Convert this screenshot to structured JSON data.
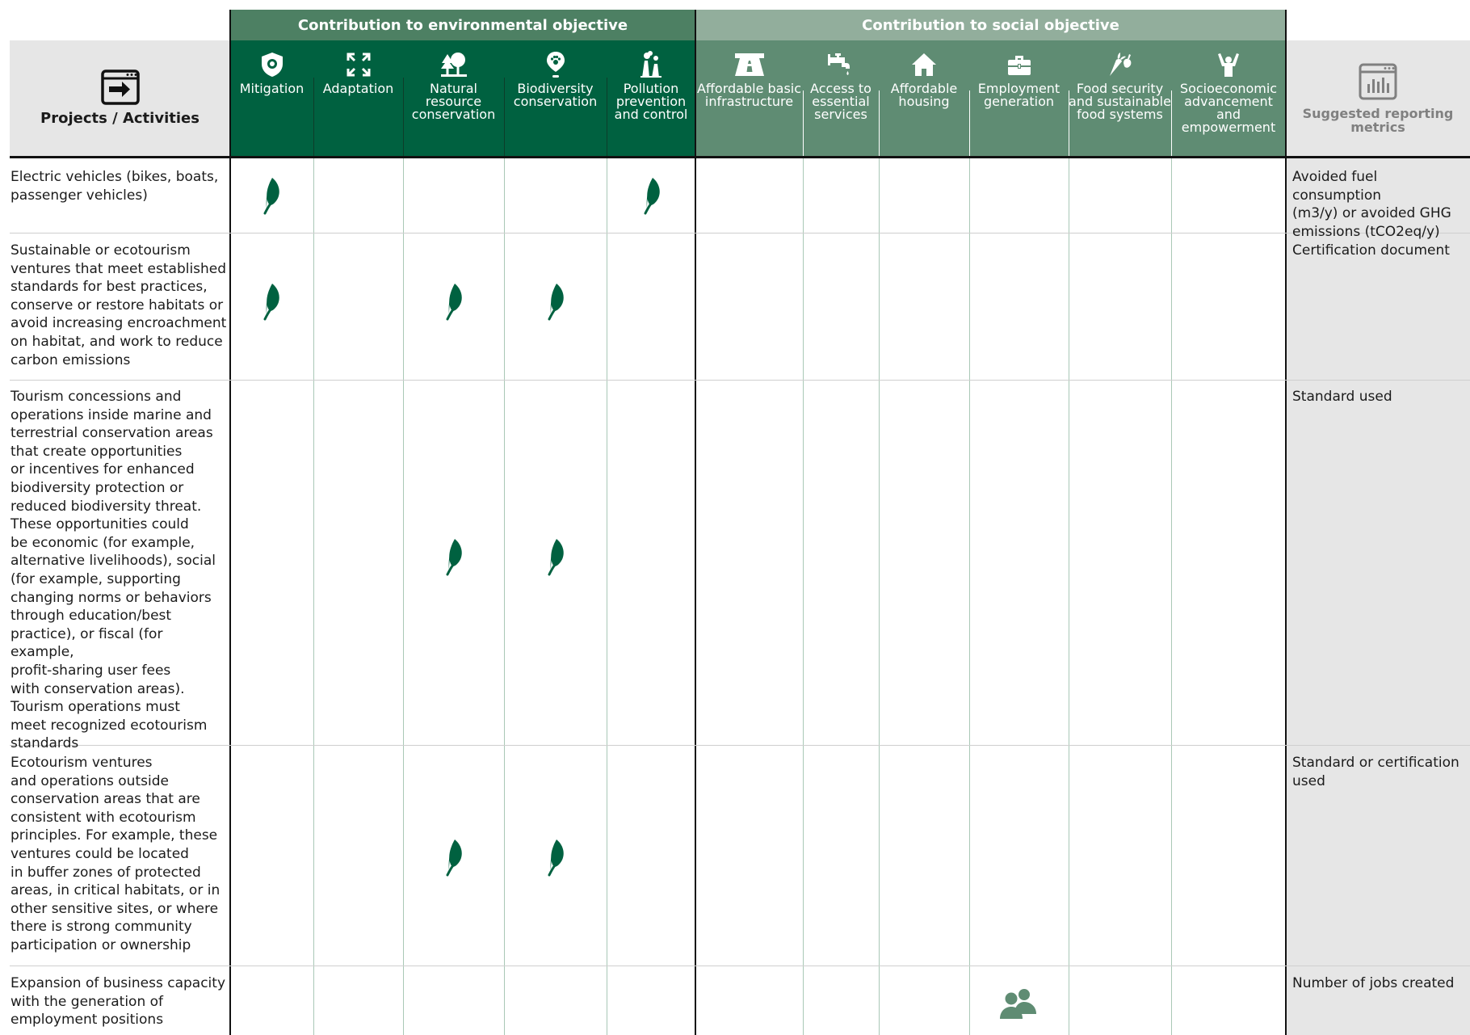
{
  "header": {
    "env_group": "Contribution to environmental objective",
    "soc_group": "Contribution to social objective",
    "projects_label": "Projects / Activities",
    "metrics_label": "Suggested reporting metrics"
  },
  "columns": [
    {
      "label": "Mitigation",
      "icon": "shield-gear-icon"
    },
    {
      "label": "Adaptation",
      "icon": "expand-arrows-icon"
    },
    {
      "label": "Natural resource conservation",
      "icon": "trees-icon"
    },
    {
      "label": "Biodiversity conservation",
      "icon": "paw-pin-icon"
    },
    {
      "label": "Pollution prevention and control",
      "icon": "factory-icon"
    },
    {
      "label": "Affordable basic infrastructure",
      "icon": "road-icon"
    },
    {
      "label": "Access to essential services",
      "icon": "water-tap-icon"
    },
    {
      "label": "Affordable housing",
      "icon": "house-icon"
    },
    {
      "label": "Employment generation",
      "icon": "briefcase-icon"
    },
    {
      "label": "Food security and sustainable food systems",
      "icon": "vegetables-icon"
    },
    {
      "label": "Socioeconomic advancement and empowerment",
      "icon": "person-raised-arms-icon"
    }
  ],
  "rows": [
    {
      "project": "Electric vehicles (bikes, boats,\npassenger vehicles)",
      "metric": "Avoided fuel consumption\n(m3/y) or avoided GHG\nemissions (tCO2eq/y)",
      "marks": [
        "leaf",
        "",
        "",
        "",
        "leaf",
        "",
        "",
        "",
        "",
        "",
        ""
      ]
    },
    {
      "project": "Sustainable or ecotourism\nventures that meet established\nstandards for best practices,\nconserve or restore habitats or\navoid increasing encroachment\non habitat, and work to reduce\ncarbon emissions",
      "metric": "Certification document",
      "marks": [
        "leaf",
        "",
        "leaf",
        "leaf",
        "",
        "",
        "",
        "",
        "",
        "",
        ""
      ]
    },
    {
      "project": "Tourism concessions and\noperations inside marine and\nterrestrial conservation areas\nthat create opportunities\nor incentives for enhanced\nbiodiversity protection or\nreduced biodiversity threat.\nThese opportunities could\nbe economic (for example,\nalternative livelihoods), social\n(for example, supporting\nchanging norms or behaviors\nthrough education/best\npractice), or fiscal (for example,\nprofit-sharing user fees\nwith conservation areas).\nTourism operations must\nmeet recognized ecotourism\nstandards",
      "metric": "Standard used",
      "marks": [
        "",
        "",
        "leaf",
        "leaf",
        "",
        "",
        "",
        "",
        "",
        "",
        ""
      ]
    },
    {
      "project": "Ecotourism ventures\nand operations outside\nconservation areas that are\nconsistent with ecotourism\nprinciples. For example, these\nventures could be located\nin buffer zones of protected\nareas, in critical habitats, or in\nother sensitive sites, or where\nthere is strong community\nparticipation or ownership",
      "metric": "Standard or certification\nused",
      "marks": [
        "",
        "",
        "leaf",
        "leaf",
        "",
        "",
        "",
        "",
        "",
        "",
        ""
      ]
    },
    {
      "project": "Expansion of business capacity\nwith the generation of\nemployment positions",
      "metric": "Number of jobs created",
      "marks": [
        "",
        "",
        "",
        "",
        "",
        "",
        "",
        "",
        "people",
        "",
        ""
      ]
    }
  ],
  "icons": {
    "projects": "document-arrow-icon",
    "metrics": "bar-chart-window-icon",
    "env_mark": "leaf-icon",
    "social_mark": "people-icon"
  },
  "colors": {
    "env_dark": "#006140",
    "env_group": "#4d8063",
    "social_header": "#5f8c73",
    "social_group": "#92ae9c",
    "grey_bg": "#e6e6e6"
  }
}
